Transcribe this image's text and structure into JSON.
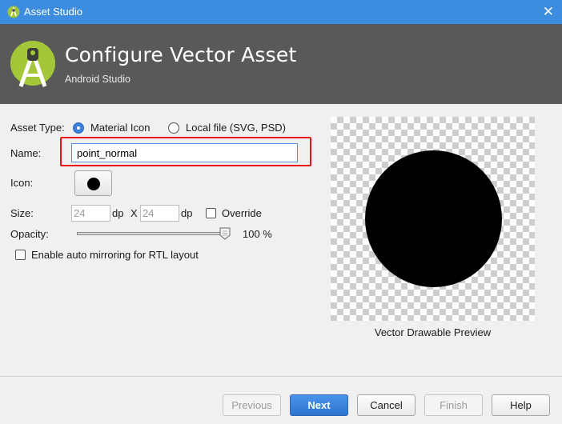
{
  "window": {
    "title": "Asset Studio",
    "app_icon": "android-studio-icon",
    "close_glyph": "✕"
  },
  "header": {
    "title": "Configure Vector Asset",
    "subtitle": "Android Studio",
    "logo": "android-studio-logo"
  },
  "form": {
    "asset_type_label": "Asset Type:",
    "asset_type_options": [
      {
        "label": "Material Icon",
        "selected": true
      },
      {
        "label": "Local file (SVG, PSD)",
        "selected": false
      }
    ],
    "name_label": "Name:",
    "name_value": "point_normal",
    "icon_label": "Icon:",
    "icon_name": "filled-circle-icon",
    "size_label": "Size:",
    "width_value": "24",
    "height_value": "24",
    "unit_dp": "dp",
    "size_separator": "X",
    "override_label": "Override",
    "override_checked": false,
    "opacity_label": "Opacity:",
    "opacity_value": 100,
    "opacity_text": "100 %",
    "rtl_label": "Enable auto mirroring for RTL layout",
    "rtl_checked": false
  },
  "preview": {
    "caption": "Vector Drawable Preview"
  },
  "buttons": {
    "previous": {
      "label": "Previous",
      "enabled": false
    },
    "next": {
      "label": "Next",
      "enabled": true
    },
    "cancel": {
      "label": "Cancel",
      "enabled": true
    },
    "finish": {
      "label": "Finish",
      "enabled": false
    },
    "help": {
      "label": "Help",
      "enabled": true
    }
  },
  "colors": {
    "title_bar": "#3c8de0",
    "header_bg": "#595959",
    "android_green": "#a4c639",
    "highlight": "#e8141a",
    "primary_button": "#3b7fd9"
  }
}
